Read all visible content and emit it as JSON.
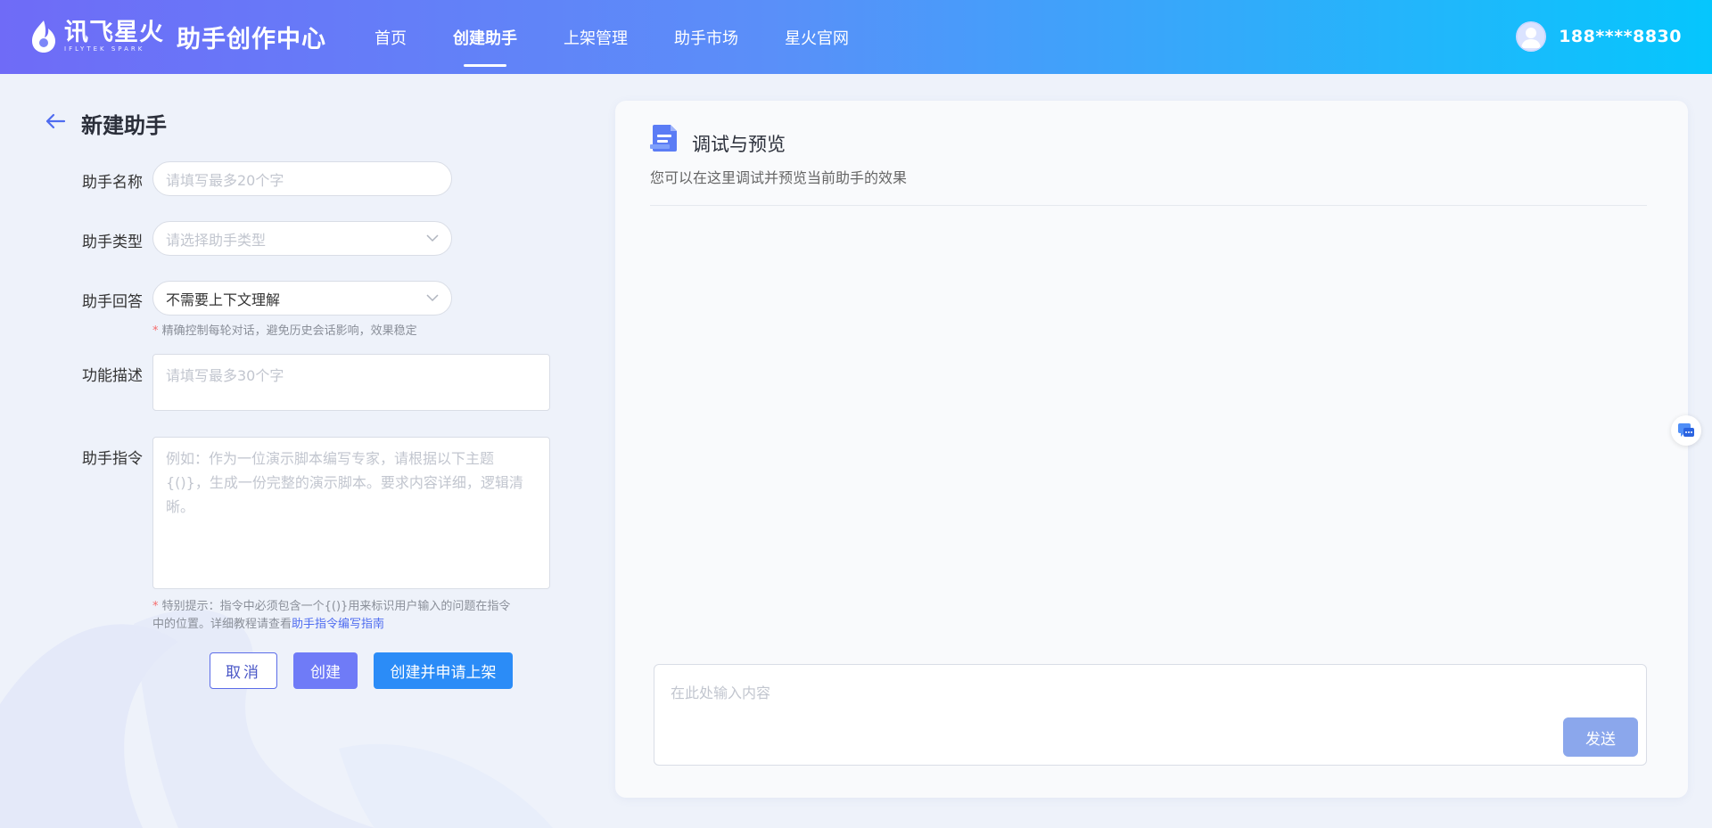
{
  "header": {
    "brand": "讯飞星火",
    "brand_sub": "IFLYTEK SPARK",
    "title": "助手创作中心",
    "nav": [
      {
        "label": "首页",
        "active": false
      },
      {
        "label": "创建助手",
        "active": true
      },
      {
        "label": "上架管理",
        "active": false
      },
      {
        "label": "助手市场",
        "active": false
      },
      {
        "label": "星火官网",
        "active": false
      }
    ],
    "user": "188****8830"
  },
  "form": {
    "page_title": "新建助手",
    "name": {
      "label": "助手名称",
      "placeholder": "请填写最多20个字"
    },
    "type": {
      "label": "助手类型",
      "placeholder": "请选择助手类型"
    },
    "answer": {
      "label": "助手回答",
      "value": "不需要上下文理解",
      "hint_star": "*",
      "hint": "精确控制每轮对话，避免历史会话影响，效果稳定"
    },
    "description": {
      "label": "功能描述",
      "placeholder": "请填写最多30个字"
    },
    "instruction": {
      "label": "助手指令",
      "placeholder": "例如：作为一位演示脚本编写专家，请根据以下主题{()}，生成一份完整的演示脚本。要求内容详细，逻辑清晰。",
      "hint_star": "*",
      "hint_line1": "特别提示：指令中必须包含一个{()}用来标识用户输入的问题在指令",
      "hint_line2": "中的位置。详细教程请查看",
      "hint_link": "助手指令编写指南"
    },
    "buttons": {
      "cancel": "取消",
      "create": "创建",
      "create_publish": "创建并申请上架"
    }
  },
  "preview": {
    "title": "调试与预览",
    "subtitle": "您可以在这里调试并预览当前助手的效果",
    "input_placeholder": "在此处输入内容",
    "send": "发送"
  },
  "colors": {
    "primary": "#2b8cf7",
    "accent": "#6f7bf7",
    "send_disabled": "#8ba7ec"
  }
}
